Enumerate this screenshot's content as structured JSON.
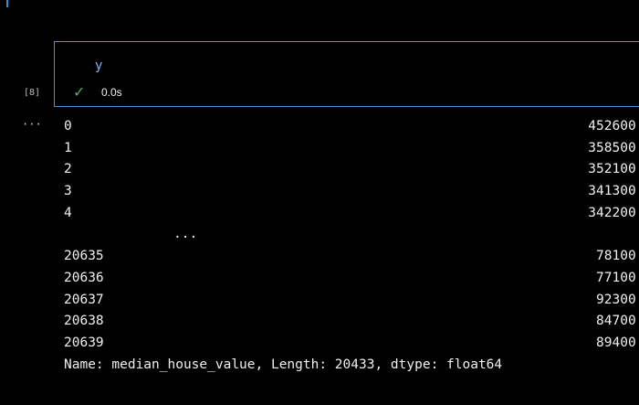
{
  "cell": {
    "code": "y",
    "execution_count": "[8]",
    "status_icon": "check-icon",
    "duration": "0.0s",
    "output_menu": "···"
  },
  "output": {
    "rows": [
      {
        "index": "0",
        "value": "452600.0"
      },
      {
        "index": "1",
        "value": "358500.0"
      },
      {
        "index": "2",
        "value": "352100.0"
      },
      {
        "index": "3",
        "value": "341300.0"
      },
      {
        "index": "4",
        "value": "342200.0"
      },
      {
        "ellipsis": "..."
      },
      {
        "index": "20635",
        "value": "78100.0"
      },
      {
        "index": "20636",
        "value": "77100.0"
      },
      {
        "index": "20637",
        "value": "92300.0"
      },
      {
        "index": "20638",
        "value": "84700.0"
      },
      {
        "index": "20639",
        "value": "89400.0"
      }
    ],
    "footer": "Name: median_house_value, Length: 20433, dtype: float64"
  },
  "colors": {
    "background": "#000000",
    "cell_border": "#4a8fd8",
    "code_text": "#7ab6ff",
    "success": "#4fb06a",
    "text": "#f0f0f0"
  }
}
